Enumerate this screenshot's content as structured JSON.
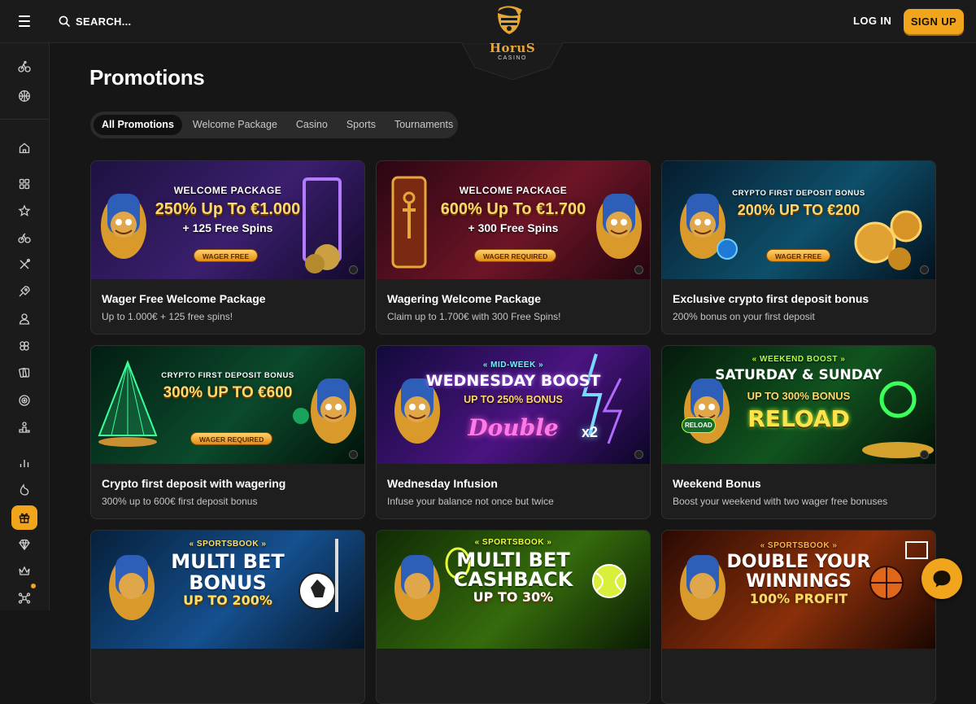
{
  "header": {
    "search_label": "SEARCH...",
    "logo_text": "HoruS",
    "logo_sub": "CASINO",
    "login_label": "LOG IN",
    "signup_label": "SIGN UP"
  },
  "sidebar": {
    "items": [
      {
        "icon": "bike-icon"
      },
      {
        "icon": "basketball-icon"
      },
      {
        "icon": "home-icon"
      },
      {
        "icon": "grid-icon"
      },
      {
        "icon": "star-icon"
      },
      {
        "icon": "cycling-icon"
      },
      {
        "icon": "x-icon"
      },
      {
        "icon": "rocket-icon"
      },
      {
        "icon": "dealer-icon"
      },
      {
        "icon": "clover-icon"
      },
      {
        "icon": "cards-icon"
      },
      {
        "icon": "roulette-icon"
      },
      {
        "icon": "podium-icon"
      },
      {
        "icon": "stats-icon"
      },
      {
        "icon": "flame-icon"
      },
      {
        "icon": "gift-icon",
        "active": true
      },
      {
        "icon": "diamond-icon"
      },
      {
        "icon": "crown-icon"
      },
      {
        "icon": "network-icon",
        "badge": true
      }
    ]
  },
  "main": {
    "title": "Promotions",
    "tabs": [
      {
        "label": "All Promotions",
        "active": true
      },
      {
        "label": "Welcome Package"
      },
      {
        "label": "Casino"
      },
      {
        "label": "Sports"
      },
      {
        "label": "Tournaments"
      }
    ],
    "cards": [
      {
        "title": "Wager Free Welcome Package",
        "desc": "Up to 1.000€ + 125 free spins!",
        "banner": {
          "kicker": "WELCOME PACKAGE",
          "big": "250% Up To €1.000",
          "mid": "+ 125 Free Spins",
          "pill": "WAGER FREE"
        },
        "colors": {
          "bg1": "#2b1a55",
          "bg2": "#5a2f8a",
          "accent": "#a86bff"
        }
      },
      {
        "title": "Wagering Welcome Package",
        "desc": "Claim up to 1.700€ with 300 Free Spins!",
        "banner": {
          "kicker": "WELCOME PACKAGE",
          "big": "600% Up To €1.700",
          "mid": "+ 300 Free Spins",
          "pill": "WAGER REQUIRED"
        },
        "colors": {
          "bg1": "#3a0b18",
          "bg2": "#7a1a2c",
          "accent": "#ff5a6e"
        }
      },
      {
        "title": "Exclusive crypto first deposit bonus",
        "desc": "200% bonus on your first deposit",
        "banner": {
          "kicker": "CRYPTO FIRST DEPOSIT BONUS",
          "big": "200% UP TO €200",
          "pill": "WAGER FREE"
        },
        "colors": {
          "bg1": "#0a2a40",
          "bg2": "#0f5c78",
          "accent": "#3fd0ff"
        }
      },
      {
        "title": "Crypto first deposit with wagering",
        "desc": "300% up to 600€ first deposit bonus",
        "banner": {
          "kicker": "CRYPTO FIRST DEPOSIT BONUS",
          "big": "300% UP TO €600",
          "pill": "WAGER REQUIRED"
        },
        "colors": {
          "bg1": "#062a1c",
          "bg2": "#0d5a3a",
          "accent": "#3bff9a"
        }
      },
      {
        "title": "Wednesday Infusion",
        "desc": "Infuse your balance not once but twice",
        "banner": {
          "kicker": "« MID-WEEK »",
          "big": "WEDNESDAY BOOST",
          "mid": "UP TO 250% BONUS",
          "extra": "Double",
          "tag": "x2"
        },
        "colors": {
          "bg1": "#1a0d4a",
          "bg2": "#5b1a8a",
          "accent": "#ff4fd8"
        }
      },
      {
        "title": "Weekend Bonus",
        "desc": "Boost your weekend with two wager free bonuses",
        "banner": {
          "kicker": "« WEEKEND BOOST »",
          "big": "SATURDAY & SUNDAY",
          "mid": "UP TO 300% BONUS",
          "extra": "RELOAD",
          "tag": "RELOAD"
        },
        "colors": {
          "bg1": "#062412",
          "bg2": "#15602a",
          "accent": "#b6ff3a"
        }
      },
      {
        "title": "",
        "desc": "",
        "banner": {
          "kicker": "« SPORTSBOOK »",
          "big": "MULTI BET",
          "mid": "BONUS",
          "extra": "UP TO 200%"
        },
        "colors": {
          "bg1": "#0b2a4a",
          "bg2": "#1a5aa0",
          "accent": "#ffe066"
        }
      },
      {
        "title": "",
        "desc": "",
        "banner": {
          "kicker": "« SPORTSBOOK »",
          "big": "MULTI BET",
          "mid": "CASHBACK",
          "extra": "UP TO 30%"
        },
        "colors": {
          "bg1": "#1a3a08",
          "bg2": "#3d7a10",
          "accent": "#eaff3a"
        }
      },
      {
        "title": "",
        "desc": "",
        "banner": {
          "kicker": "« SPORTSBOOK »",
          "big": "DOUBLE YOUR",
          "mid": "WINNINGS",
          "extra": "100% PROFIT"
        },
        "colors": {
          "bg1": "#3a1005",
          "bg2": "#9a3a0a",
          "accent": "#ffb347"
        }
      }
    ]
  },
  "chat": {
    "icon": "chat-icon"
  }
}
